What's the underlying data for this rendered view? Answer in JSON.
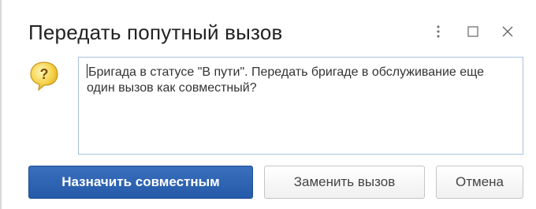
{
  "dialog": {
    "title": "Передать попутный вызов",
    "controls": {
      "more_icon": "kebab-menu-icon",
      "maximize_icon": "maximize-icon",
      "close_icon": "close-icon"
    },
    "icon": "question-icon",
    "message": "Бригада в статусе \"В пути\". Передать бригаде в обслуживание еще один вызов как совместный?",
    "buttons": {
      "assign_label": "Назначить совместным",
      "replace_label": "Заменить вызов",
      "cancel_label": "Отмена"
    },
    "colors": {
      "primary_button": "#2d63b3",
      "message_border": "#a9c1de",
      "icon_fill": "#f6d24a"
    }
  }
}
